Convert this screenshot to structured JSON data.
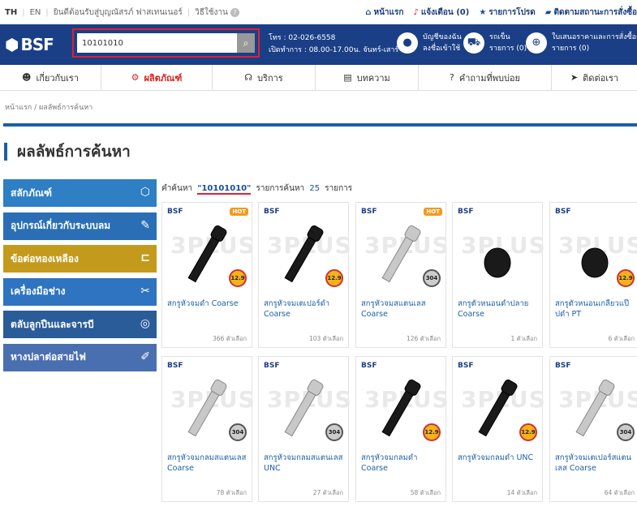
{
  "topbar": {
    "lang_th": "TH",
    "lang_en": "EN",
    "welcome": "ยินดีต้อนรับสู่บุญณัสรภ์ ฟาสเทนเนอร์",
    "howto": "วิธีใช้งาน",
    "home": "หน้าแรก",
    "notify": "แจ้งเตือน (0)",
    "favorites": "รายการโปรด",
    "track": "ติดตามสถานะการสั่งซื้อ"
  },
  "header": {
    "logo": "BSF",
    "search_value": "10101010",
    "phone": "โทร : 02-026-6558",
    "hours": "เปิดทำการ : 08.00-17.00น. จันทร์-เสาร์",
    "account_line1": "บัญชีของฉัน",
    "account_line2": "ลงชื่อเข้าใช้",
    "cart_line1": "รถเข็น",
    "cart_line2": "รายการ (0)",
    "quote_line1": "ใบเสนอราคาและการสั่งซื้อด่วน",
    "quote_line2": "รายการ (0)"
  },
  "nav": [
    {
      "label": "เกี่ยวกับเรา",
      "icon": "user-icon"
    },
    {
      "label": "ผลิตภัณฑ์",
      "icon": "bolt-icon"
    },
    {
      "label": "บริการ",
      "icon": "headset-icon"
    },
    {
      "label": "บทความ",
      "icon": "document-icon"
    },
    {
      "label": "คำถามที่พบบ่อย",
      "icon": "question-icon"
    },
    {
      "label": "ติดต่อเรา",
      "icon": "send-icon"
    }
  ],
  "breadcrumb": "หน้าแรก / ผลลัพธ์การค้นหา",
  "page_title": "ผลลัพธ์การค้นหา",
  "categories": [
    {
      "label": "สลักภัณฑ์",
      "color": "#2e7fc4"
    },
    {
      "label": "อุปกรณ์เกี่ยวกับระบบลม",
      "color": "#2a6fb6"
    },
    {
      "label": "ข้อต่อทองเหลือง",
      "color": "#c49a1c"
    },
    {
      "label": "เครื่องมือช่าง",
      "color": "#2e74c0"
    },
    {
      "label": "ตลับลูกปืนและจารบี",
      "color": "#2a5c9a"
    },
    {
      "label": "หางปลาต่อสายไฟ",
      "color": "#4a6fb0"
    }
  ],
  "results": {
    "prefix": "คำค้นหา",
    "query": "\"10101010\"",
    "middle": "รายการค้นหา",
    "count": "25",
    "suffix": "รายการ"
  },
  "products": [
    {
      "name": "สกรูหัวจมดำ Coarse",
      "count": "366 ตัวเลือก",
      "hot": true,
      "grade": "12.9",
      "style": "black"
    },
    {
      "name": "สกรูหัวจมเตเปอร์ดำ Coarse",
      "count": "103 ตัวเลือก",
      "hot": false,
      "grade": "12.9",
      "style": "black"
    },
    {
      "name": "สกรูหัวจมสแตนเลส Coarse",
      "count": "126 ตัวเลือก",
      "hot": true,
      "grade": "304",
      "style": "steel"
    },
    {
      "name": "สกรูตัวหนอนดำปลาย Coarse",
      "count": "1 ตัวเลือก",
      "hot": false,
      "grade": "",
      "style": "grub"
    },
    {
      "name": "สกรูตัวหนอนเกลียวแป๊ปดำ PT",
      "count": "6 ตัวเลือก",
      "hot": false,
      "grade": "12.9",
      "style": "grub"
    },
    {
      "name": "สกรูหัวจมกลมสแตนเลส Coarse",
      "count": "78 ตัวเลือก",
      "hot": false,
      "grade": "304",
      "style": "steel"
    },
    {
      "name": "สกรูหัวจมกลมสแตนเลส UNC",
      "count": "27 ตัวเลือก",
      "hot": false,
      "grade": "304",
      "style": "steel"
    },
    {
      "name": "สกรูหัวจมกลมดำ Coarse",
      "count": "58 ตัวเลือก",
      "hot": false,
      "grade": "12.9",
      "style": "black"
    },
    {
      "name": "สกรูหัวจมกลมดำ UNC",
      "count": "14 ตัวเลือก",
      "hot": false,
      "grade": "12.9",
      "style": "black"
    },
    {
      "name": "สกรูหัวจมเตเปอร์สแตนเลส Coarse",
      "count": "64 ตัวเลือก",
      "hot": false,
      "grade": "304",
      "style": "steel"
    }
  ],
  "brand_label": "BSF",
  "hot_label": "HOT",
  "watermark": "3PLUS"
}
